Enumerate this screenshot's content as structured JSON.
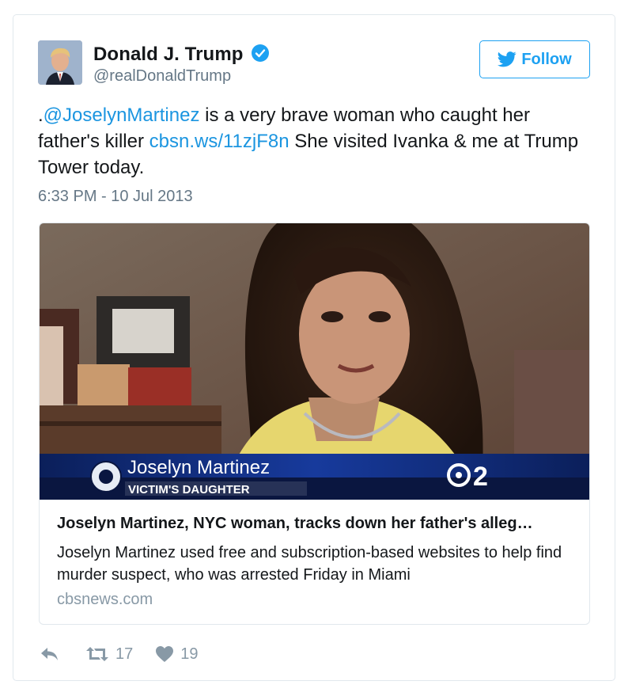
{
  "tweet": {
    "author": {
      "display_name": "Donald J. Trump",
      "handle": "@realDonaldTrump",
      "verified": true
    },
    "follow_label": "Follow",
    "text": {
      "prefix": ".",
      "mention": "@JoselynMartinez",
      "part1": " is a very brave woman who caught her father's killer ",
      "link": "cbsn.ws/11zjF8n",
      "part2": " She visited Ivanka & me at Trump Tower today."
    },
    "timestamp": "6:33 PM - 10 Jul 2013",
    "card": {
      "overlay_name": "Joselyn Martinez",
      "overlay_caption": "VICTIM'S DAUGHTER",
      "station_logo": "2",
      "title": "Joselyn Martinez, NYC woman, tracks down her father's alleg…",
      "description": "Joselyn Martinez used free and subscription-based websites to help find murder suspect, who was arrested Friday in Miami",
      "domain": "cbsnews.com"
    },
    "actions": {
      "reply_icon": "reply-icon",
      "retweet_icon": "retweet-icon",
      "retweet_count": "17",
      "like_icon": "heart-icon",
      "like_count": "19"
    }
  },
  "colors": {
    "link": "#1b95e0",
    "twitter_blue": "#1da1f2",
    "secondary_text": "#657786",
    "muted_icon": "#8899a6",
    "border": "#e1e8ed"
  }
}
